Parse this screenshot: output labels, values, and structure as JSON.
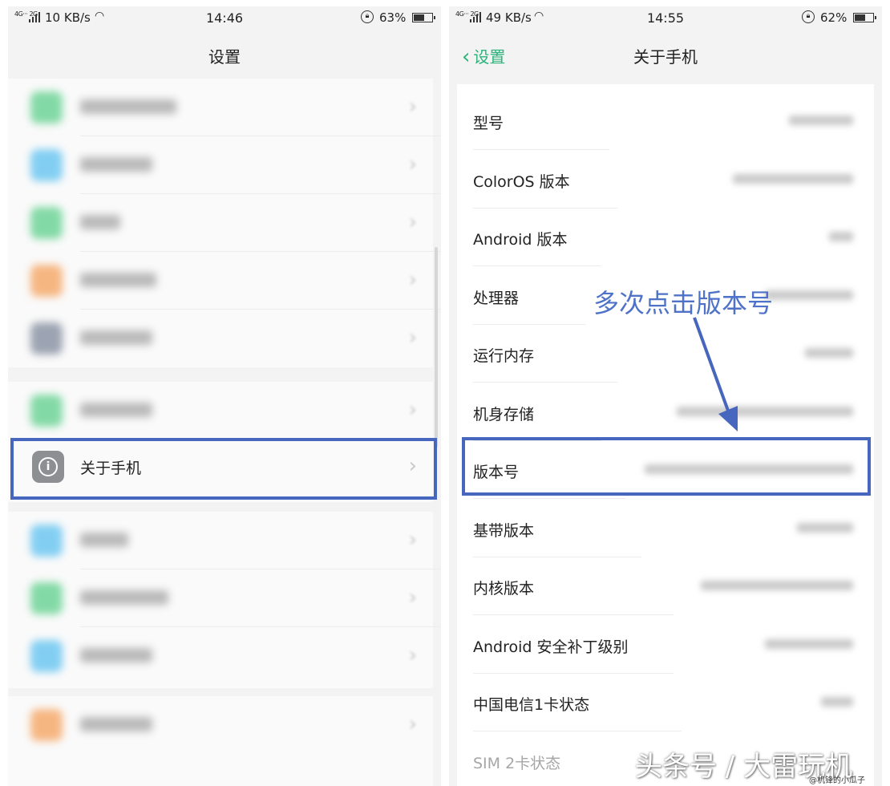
{
  "left": {
    "status": {
      "network": "4G··· 2G",
      "speed": "10 KB/s",
      "time": "14:46",
      "battery": "63%",
      "battery_level": 0.63
    },
    "title": "设置",
    "blurred_items": [
      {
        "color": "#5ccf8a"
      },
      {
        "color": "#5bc0f0"
      },
      {
        "color": "#5ccf8a"
      },
      {
        "color": "#f5a05a"
      },
      {
        "color": "#7d879a"
      },
      {
        "color": "#5ccf8a"
      },
      {
        "color": "#5bc0f0"
      },
      {
        "color": "#5ccf8a"
      },
      {
        "color": "#5bc0f0"
      },
      {
        "color": "#f5a05a"
      }
    ],
    "about": {
      "label": "关于手机",
      "icon": "info-icon"
    }
  },
  "right": {
    "status": {
      "network": "4G··· 2G",
      "speed": "49 KB/s",
      "time": "14:55",
      "battery": "62%",
      "battery_level": 0.62
    },
    "back_label": "设置",
    "title": "关于手机",
    "items": [
      {
        "label": "型号"
      },
      {
        "label": "ColorOS 版本"
      },
      {
        "label": "Android 版本"
      },
      {
        "label": "处理器"
      },
      {
        "label": "运行内存"
      },
      {
        "label": "机身存储"
      },
      {
        "label": "版本号"
      },
      {
        "label": "基带版本"
      },
      {
        "label": "内核版本"
      },
      {
        "label": "Android 安全补丁级别"
      },
      {
        "label": "中国电信1卡状态"
      },
      {
        "label": "SIM 2卡状态"
      }
    ]
  },
  "annotation": "多次点击版本号",
  "watermark": "头条号 / 大雷玩机",
  "credit": "@机锋的小瓜子",
  "colors": {
    "accent": "#2db37a",
    "highlight": "#4766bd",
    "annotation": "#4f72c9"
  }
}
